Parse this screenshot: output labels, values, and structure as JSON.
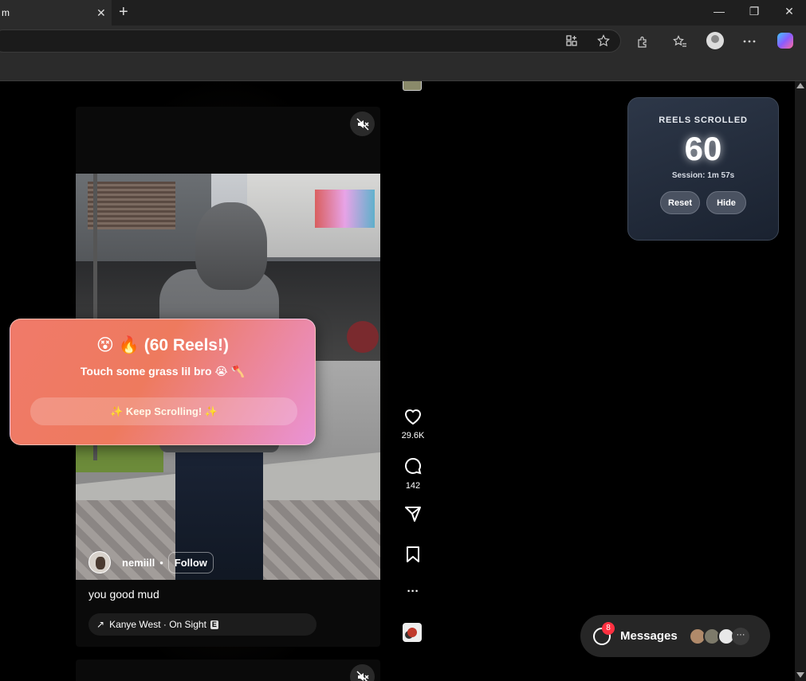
{
  "browser": {
    "tab_title": "m",
    "tab_close": "✕",
    "new_tab": "+",
    "minimize": "—",
    "restore": "❐",
    "close": "✕"
  },
  "reel": {
    "author": "nemiill",
    "separator": "•",
    "follow_label": "Follow",
    "caption": "you good mud",
    "audio": "Kanye West · On Sight",
    "explicit_badge": "E",
    "audio_arrow": "↗"
  },
  "actions": {
    "likes": "29.6K",
    "comments": "142",
    "more": "···"
  },
  "counter": {
    "label": "REELS SCROLLED",
    "value": "60",
    "session": "Session: 1m 57s",
    "reset_label": "Reset",
    "hide_label": "Hide"
  },
  "popup": {
    "title": "😵 🔥 (60 Reels!)",
    "subtitle": "Touch some grass lil bro 😭 🪓",
    "button_label": "✨ Keep Scrolling! ✨"
  },
  "messages": {
    "label": "Messages",
    "badge": "8",
    "more": "···"
  },
  "colors": {
    "popup_start": "#f07a6a",
    "popup_end": "#e993d6",
    "counter_bg": "#2d3748",
    "badge": "#ff3040"
  }
}
